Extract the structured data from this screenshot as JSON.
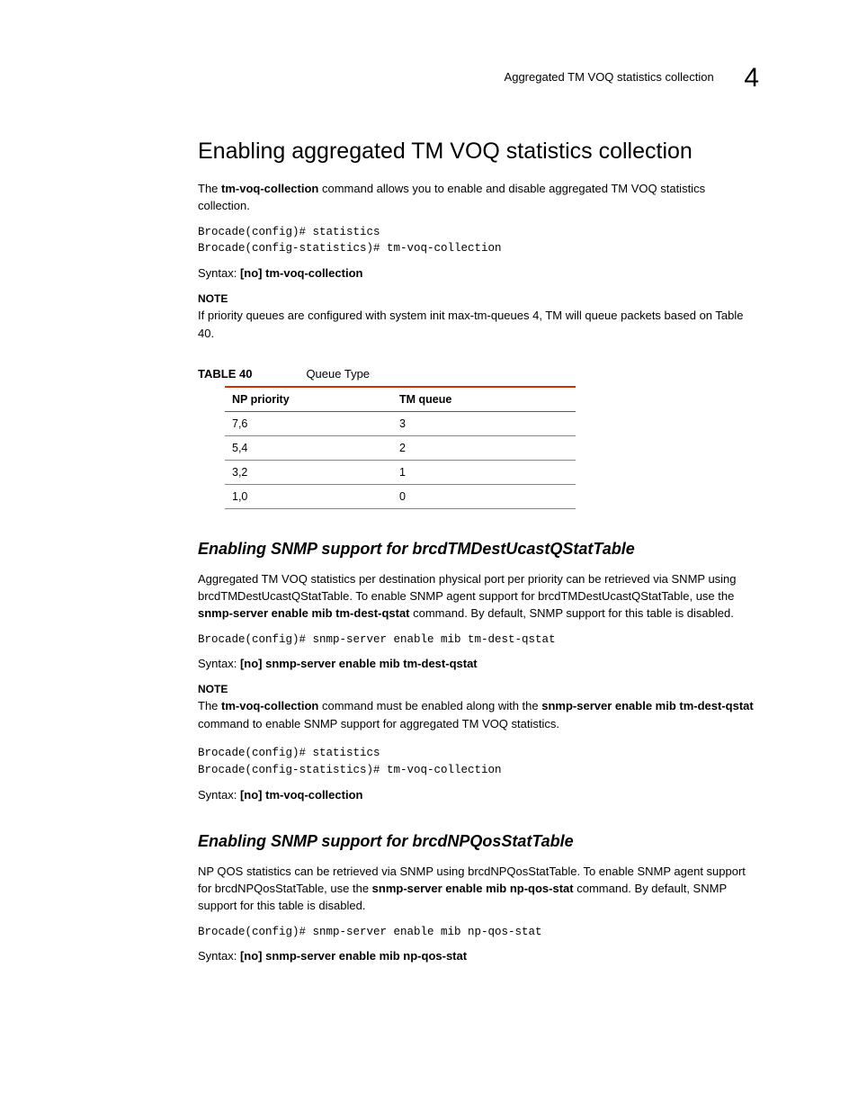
{
  "header": {
    "running_title": "Aggregated TM VOQ statistics collection",
    "chapter_number": "4"
  },
  "section1": {
    "title": "Enabling aggregated TM VOQ statistics collection",
    "intro_pre": "The ",
    "intro_cmd": "tm-voq-collection",
    "intro_post": " command allows you to enable and disable aggregated TM VOQ statistics collection.",
    "code": "Brocade(config)# statistics\nBrocade(config-statistics)# tm-voq-collection",
    "syntax_label": "Syntax:  ",
    "syntax_value": "[no] tm-voq-collection",
    "note_label": "NOTE",
    "note_body": "If priority queues are configured with system init max-tm-queues 4, TM will queue packets based on Table 40."
  },
  "table40": {
    "label": "TABLE 40",
    "caption": "Queue Type",
    "headers": [
      "NP priority",
      "TM queue"
    ],
    "rows": [
      [
        "7,6",
        "3"
      ],
      [
        "5,4",
        "2"
      ],
      [
        "3,2",
        "1"
      ],
      [
        "1,0",
        "0"
      ]
    ]
  },
  "section2": {
    "title": "Enabling SNMP support for brcdTMDestUcastQStatTable",
    "para_a": "Aggregated TM VOQ statistics per destination physical port per priority can be retrieved via SNMP using brcdTMDestUcastQStatTable. To enable SNMP agent support for brcdTMDestUcastQStatTable, use the ",
    "para_cmd": "snmp-server enable mib tm-dest-qstat",
    "para_b": " command. By default, SNMP support for this table is disabled.",
    "code1": "Brocade(config)# snmp-server enable mib tm-dest-qstat",
    "syntax1_label": "Syntax:  ",
    "syntax1_value": "[no] snmp-server enable mib tm-dest-qstat",
    "note_label": "NOTE",
    "note_a": "The ",
    "note_cmd1": "tm-voq-collection",
    "note_b": " command must be enabled along with the ",
    "note_cmd2": "snmp-server enable mib tm-dest-qstat",
    "note_c": " command to enable SNMP support for aggregated TM VOQ statistics.",
    "code2": "Brocade(config)# statistics\nBrocade(config-statistics)# tm-voq-collection",
    "syntax2_label": "Syntax:  ",
    "syntax2_value": "[no] tm-voq-collection"
  },
  "section3": {
    "title": "Enabling SNMP support for brcdNPQosStatTable",
    "para_a": "NP QOS statistics can be retrieved via SNMP using brcdNPQosStatTable. To enable SNMP agent support for brcdNPQosStatTable, use the ",
    "para_cmd": "snmp-server enable mib np-qos-stat",
    "para_b": " command. By default, SNMP support for this table is disabled.",
    "code": "Brocade(config)# snmp-server enable mib np-qos-stat",
    "syntax_label": "Syntax:  ",
    "syntax_value": "[no] snmp-server enable mib np-qos-stat"
  }
}
